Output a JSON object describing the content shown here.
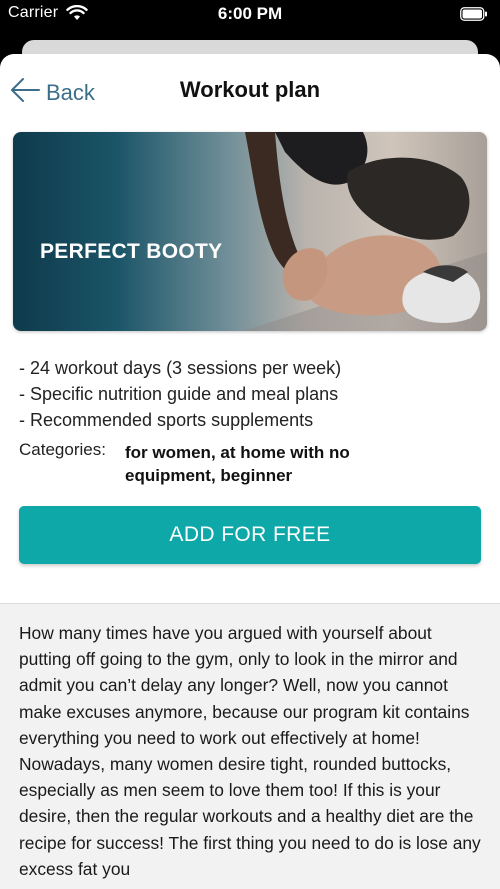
{
  "status_bar": {
    "carrier": "Carrier",
    "time": "6:00 PM"
  },
  "nav": {
    "back_label": "Back",
    "title": "Workout plan"
  },
  "hero": {
    "title": "PERFECT BOOTY"
  },
  "features": [
    "- 24 workout days (3 sessions per week)",
    "- Specific nutrition guide and meal plans",
    "- Recommended sports supplements"
  ],
  "categories": {
    "label": "Categories:",
    "value": "for women, at home with no equipment, beginner"
  },
  "cta": {
    "label": "ADD FOR FREE",
    "color": "#0ea8a9"
  },
  "description": "How many times have you argued with yourself about putting off going to the gym, only to look in the mirror and admit you can’t delay any longer? Well, now you cannot make excuses anymore, because our program kit contains everything you need to work out effectively at home! Nowadays, many women desire tight, rounded buttocks, especially as men seem to love them too! If this is your desire, then the regular workouts and a healthy diet are the recipe for success! The first thing you need to do is lose any excess fat you"
}
